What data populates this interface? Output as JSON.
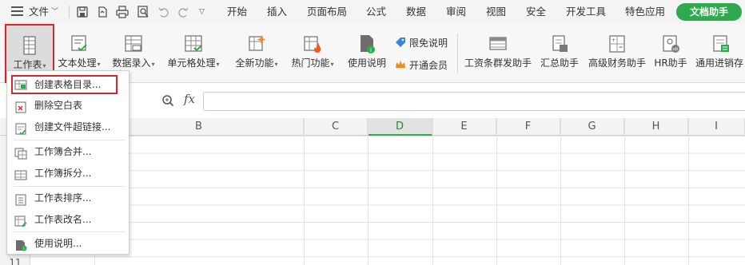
{
  "menubar": {
    "file_label": "文件",
    "tabs": [
      "开始",
      "插入",
      "页面布局",
      "公式",
      "数据",
      "审阅",
      "视图",
      "安全",
      "开发工具",
      "特色应用"
    ],
    "doc_helper_label": "文档助手",
    "doc_helper_color": "#2fa84f"
  },
  "ribbon": {
    "buttons": [
      {
        "label": "工作表",
        "icon": "worksheet-icon"
      },
      {
        "label": "文本处理",
        "icon": "text-process-icon"
      },
      {
        "label": "数据录入",
        "icon": "data-entry-icon"
      },
      {
        "label": "单元格处理",
        "icon": "cell-process-icon"
      },
      {
        "label": "全新功能",
        "icon": "new-feature-icon"
      },
      {
        "label": "热门功能",
        "icon": "hot-feature-icon"
      },
      {
        "label": "使用说明",
        "icon": "help-doc-icon"
      },
      {
        "label": "工资条群发助手",
        "icon": "payslip-icon"
      },
      {
        "label": "汇总助手",
        "icon": "summary-icon"
      },
      {
        "label": "高级财务助手",
        "icon": "finance-icon"
      },
      {
        "label": "HR助手",
        "icon": "hr-icon"
      },
      {
        "label": "通用进销存",
        "icon": "inventory-icon"
      }
    ],
    "limited_free_label": "限免说明",
    "vip_label": "开通会员",
    "active_border_color": "#d9262c"
  },
  "formula_bar": {
    "fx_label": "fx",
    "value": ""
  },
  "grid": {
    "columns": [
      "B",
      "C",
      "D",
      "E",
      "F",
      "G",
      "H",
      "I"
    ],
    "selected_column": "D",
    "visible_row_label": "11"
  },
  "dropdown": {
    "items": [
      {
        "label": "创建表格目录...",
        "icon": "create-toc-icon"
      },
      {
        "label": "删除空白表",
        "icon": "delete-blank-sheet-icon"
      },
      {
        "label": "创建文件超链接...",
        "icon": "file-hyperlink-icon"
      },
      {
        "label": "工作簿合并...",
        "icon": "workbook-merge-icon"
      },
      {
        "label": "工作簿拆分...",
        "icon": "workbook-split-icon"
      },
      {
        "label": "工作表排序...",
        "icon": "sheet-sort-icon"
      },
      {
        "label": "工作表改名...",
        "icon": "sheet-rename-icon"
      },
      {
        "label": "使用说明...",
        "icon": "usage-help-icon"
      }
    ]
  }
}
